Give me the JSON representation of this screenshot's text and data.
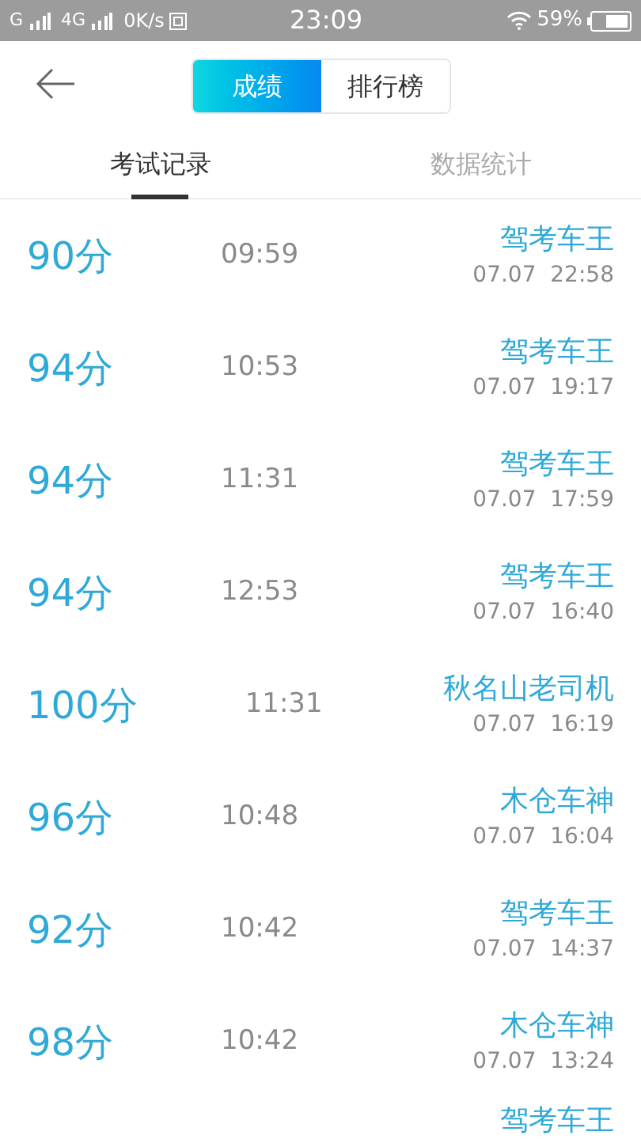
{
  "status_bar": {
    "network_1": "G",
    "network_2": "4G",
    "speed": "0K/s",
    "time": "23:09",
    "battery": "59%"
  },
  "segments": [
    {
      "label": "成绩",
      "selected": true
    },
    {
      "label": "排行榜",
      "selected": false
    }
  ],
  "tabs": [
    {
      "label": "考试记录",
      "selected": true
    },
    {
      "label": "数据统计",
      "selected": false
    }
  ],
  "records": [
    {
      "score": "90分",
      "duration": "09:59",
      "title": "驾考车王",
      "date": "07.07  22:58"
    },
    {
      "score": "94分",
      "duration": "10:53",
      "title": "驾考车王",
      "date": "07.07  19:17"
    },
    {
      "score": "94分",
      "duration": "11:31",
      "title": "驾考车王",
      "date": "07.07  17:59"
    },
    {
      "score": "94分",
      "duration": "12:53",
      "title": "驾考车王",
      "date": "07.07  16:40"
    },
    {
      "score": "100分",
      "duration": "11:31",
      "title": "秋名山老司机",
      "date": "07.07  16:19"
    },
    {
      "score": "96分",
      "duration": "10:48",
      "title": "木仓车神",
      "date": "07.07  16:04"
    },
    {
      "score": "92分",
      "duration": "10:42",
      "title": "驾考车王",
      "date": "07.07  14:37"
    },
    {
      "score": "98分",
      "duration": "10:42",
      "title": "木仓车神",
      "date": "07.07  13:24"
    },
    {
      "title": "驾考车王"
    }
  ]
}
